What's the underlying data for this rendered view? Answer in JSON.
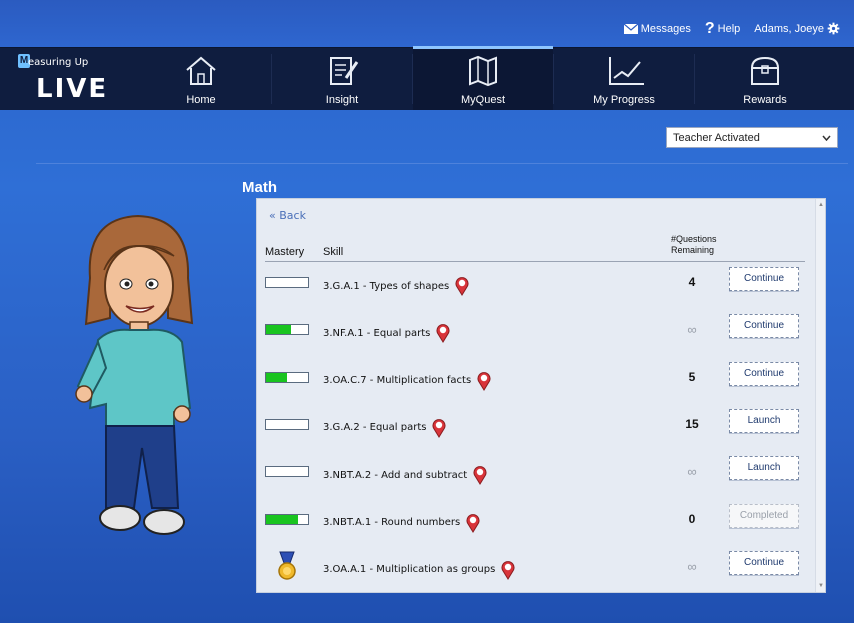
{
  "topbar": {
    "messages_label": "Messages",
    "help_label": "Help",
    "user_name": "Adams, Joeye"
  },
  "logo": {
    "line1": "easuring Up",
    "badge": "M",
    "line2": "LIVE"
  },
  "nav": {
    "items": [
      {
        "label": "Home",
        "icon": "home-icon"
      },
      {
        "label": "Insight",
        "icon": "insight-icon"
      },
      {
        "label": "MyQuest",
        "icon": "map-icon",
        "active": true
      },
      {
        "label": "My Progress",
        "icon": "chart-icon"
      },
      {
        "label": "Rewards",
        "icon": "treasure-chest-icon"
      }
    ]
  },
  "filter": {
    "selected": "Teacher Activated"
  },
  "subject": "Math",
  "panel": {
    "back_label": "Back",
    "headers": {
      "mastery": "Mastery",
      "skill": "Skill",
      "remaining_line1": "#Questions",
      "remaining_line2": "Remaining"
    },
    "rows": [
      {
        "skill": "3.G.A.1 - Types of shapes",
        "mastery": 0,
        "questions": "4",
        "action": "Continue"
      },
      {
        "skill": "3.NF.A.1 - Equal parts",
        "mastery": 0.6,
        "questions": "∞",
        "action": "Continue"
      },
      {
        "skill": "3.OA.C.7 - Multiplication facts",
        "mastery": 0.5,
        "questions": "5",
        "action": "Continue"
      },
      {
        "skill": "3.G.A.2 - Equal parts",
        "mastery": 0,
        "questions": "15",
        "action": "Launch"
      },
      {
        "skill": "3.NBT.A.2 - Add and subtract",
        "mastery": 0,
        "questions": "∞",
        "action": "Launch"
      },
      {
        "skill": "3.NBT.A.1 - Round numbers",
        "mastery": 0.75,
        "questions": "0",
        "action": "Completed"
      },
      {
        "skill": "3.OA.A.1 - Multiplication as groups",
        "mastery": 1,
        "medal": true,
        "questions": "∞",
        "action": "Continue"
      }
    ]
  },
  "colors": {
    "mastery_fill": "#19c41f",
    "nav_bg": "#0f1d3f",
    "pin": "#d9343a"
  }
}
